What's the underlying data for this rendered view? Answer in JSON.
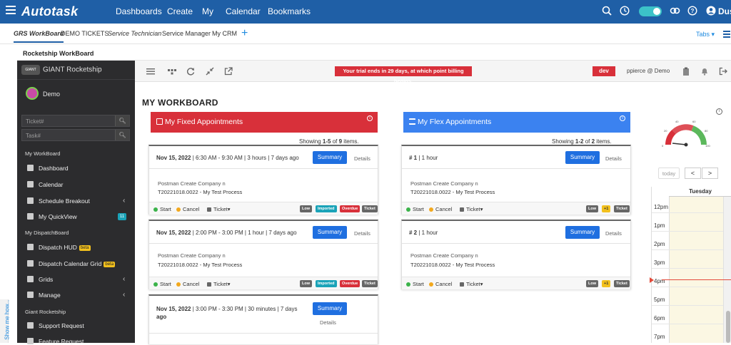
{
  "topnav": {
    "logo": "Autotask",
    "items": [
      "Dashboards",
      "Create",
      "My",
      "Calendar",
      "Bookmarks"
    ],
    "user_short": "Dus",
    "bg_color": "#1f5fa6"
  },
  "tabs": {
    "items": [
      "GRS WorkBoard",
      "DEMO TICKETS",
      "Service Technician",
      "Service Manager",
      "My CRM"
    ],
    "tabs_button": "Tabs"
  },
  "page_title": "Rocketship WorkBoard",
  "show_me": "Show me how...",
  "sidebar": {
    "brand": "GIANT Rocketship",
    "brand_logo": "GIANT",
    "user": "Demo",
    "ticket_placeholder": "Ticket#",
    "task_placeholder": "Task#",
    "sections": {
      "my_workboard": "My WorkBoard",
      "my_dispatchboard": "My DispatchBoard",
      "giant_rocketship": "Giant Rocketship"
    },
    "items": {
      "dashboard": "Dashboard",
      "calendar": "Calendar",
      "schedule_breakout": "Schedule Breakout",
      "my_quickview": "My QuickView",
      "quickview_count": "11",
      "dispatch_hud": "Dispatch HUD",
      "dispatch_calendar_grid": "Dispatch Calendar Grid",
      "beta": "beta",
      "grids": "Grids",
      "manage": "Manage",
      "support_request": "Support Request",
      "feature_request": "Feature Request"
    }
  },
  "toolbar": {
    "trial_message": "Your trial ends in 29 days, at which point billing begins.",
    "env_badge": "dev",
    "user": "ppierce @ Demo"
  },
  "workboard": {
    "title": "MY WORKBOARD",
    "fixed": {
      "title": "My Fixed Appointments",
      "color": "#d8303a",
      "showing_prefix": "Showing ",
      "showing_range": "1-5",
      "showing_mid": " of ",
      "showing_total": "9",
      "showing_suffix": " items.",
      "cards": [
        {
          "date": "Nov 15, 2022",
          "meta": " | 6:30 AM - 9:30 AM | 3 hours | 7 days ago",
          "company": "Postman Create Company n",
          "ticket": "T20221018.0022 - My Test Process"
        },
        {
          "date": "Nov 15, 2022",
          "meta": " | 2:00 PM - 3:00 PM | 1 hour | 7 days ago",
          "company": "Postman Create Company n",
          "ticket": "T20221018.0022 - My Test Process"
        },
        {
          "date": "Nov 15, 2022",
          "meta": " | 3:00 PM - 3:30 PM | 30 minutes | 7 days",
          "meta2": "ago"
        }
      ]
    },
    "flex": {
      "title": "My Flex Appointments",
      "color": "#3b82f0",
      "showing_prefix": "Showing ",
      "showing_range": "1-2",
      "showing_mid": " of ",
      "showing_total": "2",
      "showing_suffix": " items.",
      "cards": [
        {
          "num": "# 1",
          "meta": " | 1 hour",
          "company": "Postman Create Company n",
          "ticket": "T20221018.0022 - My Test Process"
        },
        {
          "num": "# 2",
          "meta": " | 1 hour",
          "company": "Postman Create Company n",
          "ticket": "T20221018.0022 - My Test Process"
        }
      ]
    },
    "labels": {
      "summary": "Summary",
      "details": "Details",
      "start": "Start",
      "cancel": "Cancel",
      "ticket": "Ticket",
      "low": "Low",
      "imported": "Imported",
      "overdue": "Overdue",
      "ticket_tag": "Ticket",
      "plus_one": "+1"
    }
  },
  "gauge": {
    "ticks": [
      "0",
      "20",
      "40",
      "60",
      "80",
      "100"
    ]
  },
  "calendar": {
    "today": "today",
    "prev": "<",
    "next": ">",
    "day": "Tuesday",
    "hours": [
      "12pm",
      "1pm",
      "2pm",
      "3pm",
      "4pm",
      "5pm",
      "6pm",
      "7pm"
    ]
  }
}
